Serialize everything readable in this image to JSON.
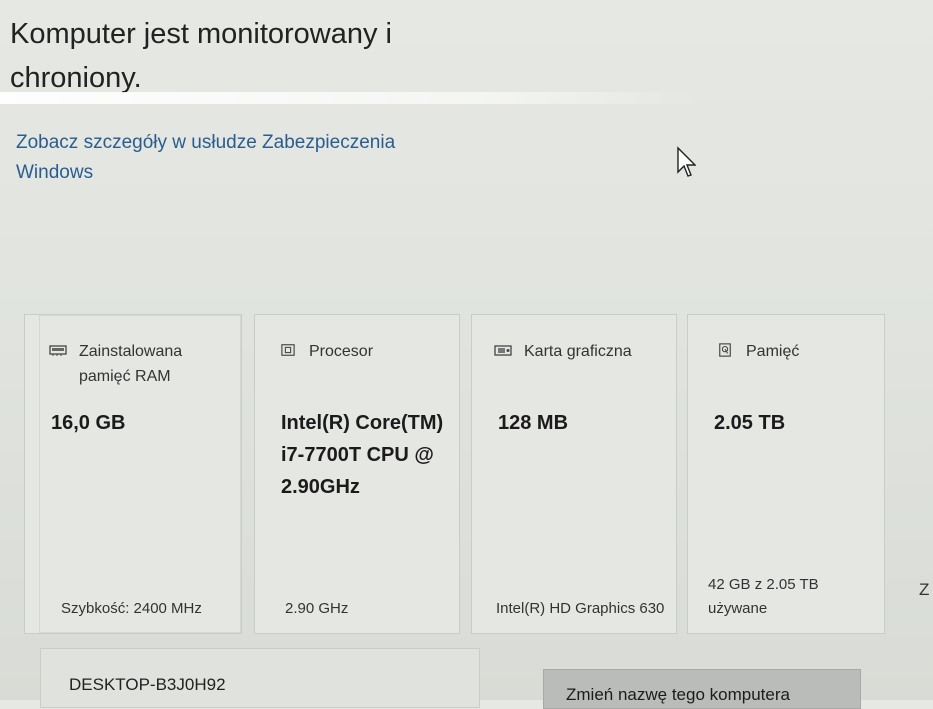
{
  "header": {
    "title": "Komputer jest monitorowany i chroniony.",
    "details_link": "Zobacz szczegóły w usłudze Zabezpieczenia Windows"
  },
  "specs": [
    {
      "icon": "ram-icon",
      "label": "Zainstalowana pamięć RAM",
      "value": "16,0 GB",
      "footer": "Szybkość: 2400 MHz"
    },
    {
      "icon": "processor-icon",
      "label": "Procesor",
      "value": "Intel(R) Core(TM) i7-7700T CPU @ 2.90GHz",
      "footer": "2.90 GHz"
    },
    {
      "icon": "graphics-card-icon",
      "label": "Karta graficzna",
      "value": "128 MB",
      "footer": "Intel(R) HD Graphics 630"
    },
    {
      "icon": "storage-icon",
      "label": "Pamięć",
      "value": "2.05 TB",
      "footer": "42 GB z 2.05 TB używane"
    }
  ],
  "device": {
    "name": "DESKTOP-B3J0H92",
    "rename_button": "Zmień nazwę tego komputera"
  },
  "colors": {
    "background": "#e3e5e1",
    "link": "#2a5d8f",
    "tile": "#e5e7e3",
    "button": "#b9bcb8"
  }
}
